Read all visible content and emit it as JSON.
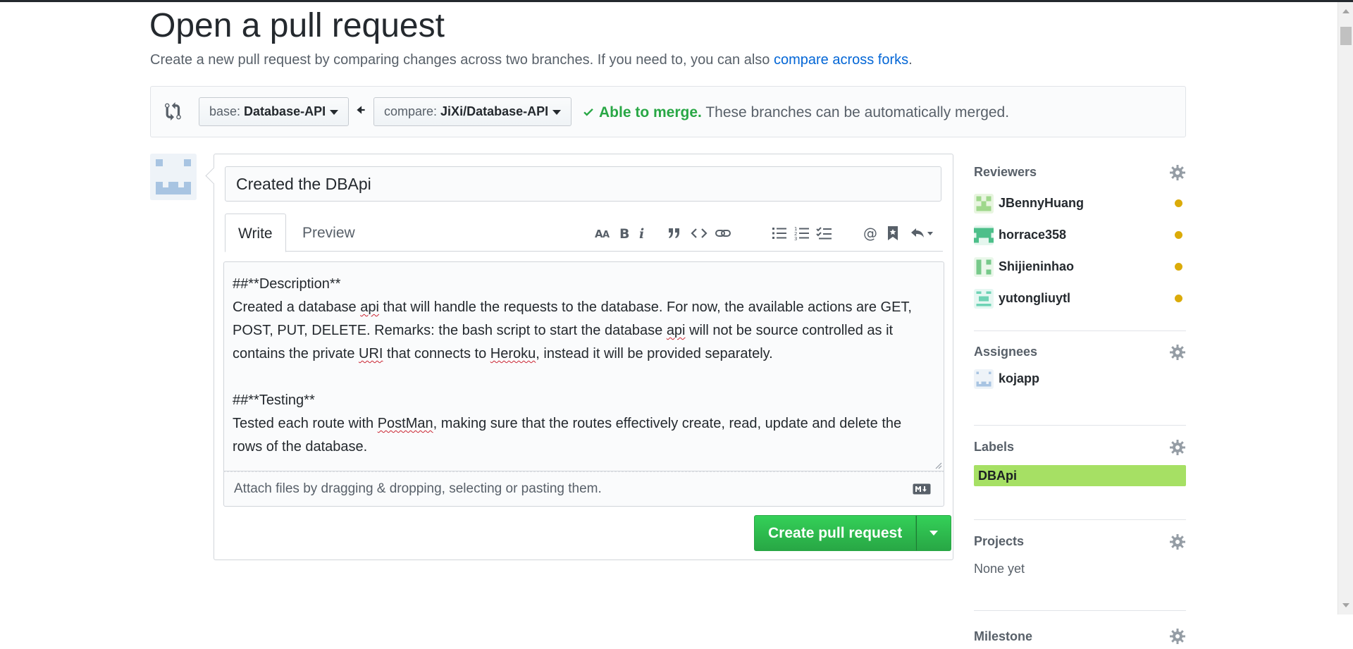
{
  "page": {
    "title": "Open a pull request",
    "subtitle": "Create a new pull request by comparing changes across two branches. If you need to, you can also ",
    "subtitle_link": "compare across forks",
    "subtitle_end": "."
  },
  "range": {
    "base_prefix": "base: ",
    "base_branch": "Database-API",
    "compare_prefix": "compare: ",
    "compare_branch": "JiXi/Database-API",
    "merge_ok": "Able to merge.",
    "merge_msg": " These branches can be automatically merged."
  },
  "composer": {
    "title_value": "Created the DBApi",
    "tabs": [
      "Write",
      "Preview"
    ],
    "body_lines": [
      "##**Description**",
      "Created a database api that will handle the requests to the database. For now, the available actions are GET,",
      "POST, PUT, DELETE. Remarks: the bash script to start the database api will not be source controlled as it",
      "contains the private URI that connects to Heroku, instead it will be provided separately.",
      "",
      "##**Testing**",
      "Tested each route with PostMan, making sure that the routes effectively create, read, update and delete the",
      "rows of the database."
    ],
    "attach_text": "Attach files by dragging & dropping, selecting or pasting them.",
    "create_label": "Create pull request"
  },
  "sidebar": {
    "reviewers_heading": "Reviewers",
    "reviewers": [
      {
        "name": "JBennyHuang",
        "status_color": "#dbab09"
      },
      {
        "name": "horrace358",
        "status_color": "#dbab09"
      },
      {
        "name": "Shijieninhao",
        "status_color": "#dbab09"
      },
      {
        "name": "yutongliuytl",
        "status_color": "#dbab09"
      }
    ],
    "assignees_heading": "Assignees",
    "assignee": "kojapp",
    "labels_heading": "Labels",
    "label": "DBApi",
    "label_color": "#a6e064",
    "projects_heading": "Projects",
    "projects_value": "None yet",
    "milestone_heading": "Milestone"
  },
  "colors": {
    "accent_link": "#0366d6",
    "success": "#28a745",
    "pending": "#dbab09"
  }
}
